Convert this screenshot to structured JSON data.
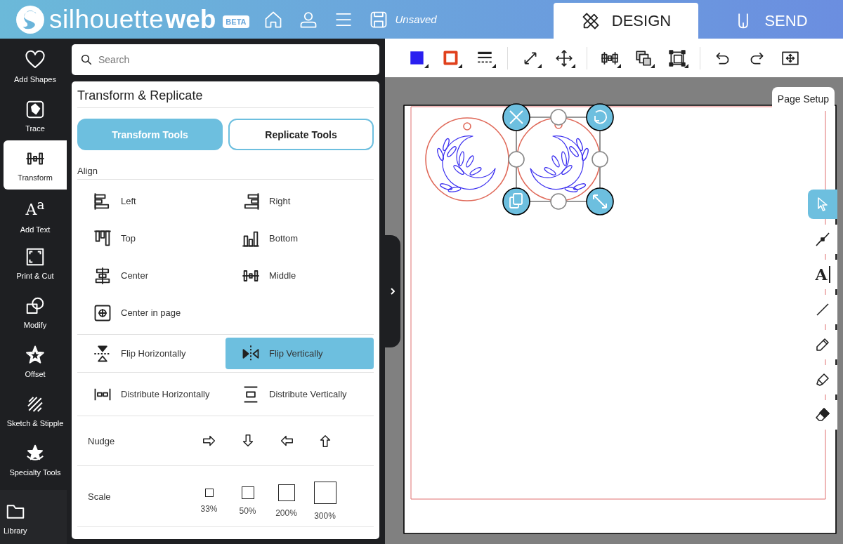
{
  "header": {
    "logo_light": "silhouette",
    "logo_bold": "web",
    "badge": "BETA",
    "doc_status": "Unsaved",
    "tabs": [
      {
        "label": "DESIGN",
        "kind": "design",
        "selected": true
      },
      {
        "label": "SEND",
        "kind": "send",
        "selected": false
      }
    ]
  },
  "sidebar": {
    "items": [
      {
        "label": "Add Shapes",
        "kind": "heart",
        "selected": false
      },
      {
        "label": "Trace",
        "kind": "trace",
        "selected": false
      },
      {
        "label": "Transform",
        "kind": "middle",
        "selected": true
      },
      {
        "label": "Add Text",
        "kind": "text",
        "glyph": "A$^{a}$",
        "selected": false
      },
      {
        "label": "Print & Cut",
        "kind": "printcut",
        "selected": false
      },
      {
        "label": "Modify",
        "kind": "modify",
        "selected": false
      },
      {
        "label": "Offset",
        "kind": "offset",
        "selected": false
      },
      {
        "label": "Sketch & Stipple",
        "kind": "sketch",
        "selected": false
      },
      {
        "label": "Specialty Tools",
        "kind": "specialty",
        "selected": false
      }
    ],
    "library": {
      "label": "Library",
      "kind": "folder",
      "selected": false
    }
  },
  "search": {
    "placeholder": "Search"
  },
  "panel": {
    "title": "Transform & Replicate",
    "tabs": [
      {
        "label": "Transform Tools",
        "selected": true
      },
      {
        "label": "Replicate Tools",
        "selected": false
      }
    ],
    "align_label": "Align",
    "align": [
      {
        "label": "Left",
        "kind": "left"
      },
      {
        "label": "Right",
        "kind": "right"
      },
      {
        "label": "Top",
        "kind": "top"
      },
      {
        "label": "Bottom",
        "kind": "bottom"
      },
      {
        "label": "Center",
        "kind": "center"
      },
      {
        "label": "Middle",
        "kind": "middle"
      },
      {
        "label": "Center in page",
        "kind": "centerpage"
      }
    ],
    "flip": [
      {
        "label": "Flip Horizontally",
        "kind": "fliph",
        "selected": false
      },
      {
        "label": "Flip Vertically",
        "kind": "flipv",
        "selected": true
      }
    ],
    "distribute": [
      {
        "label": "Distribute Horizontally",
        "kind": "disth"
      },
      {
        "label": "Distribute Vertically",
        "kind": "distv"
      }
    ],
    "nudge": {
      "label": "Nudge",
      "arrows": [
        {
          "kind": "right"
        },
        {
          "kind": "down"
        },
        {
          "kind": "left"
        },
        {
          "kind": "up"
        }
      ]
    },
    "scale": {
      "label": "Scale",
      "options": [
        "33%",
        "50%",
        "200%",
        "300%"
      ]
    }
  },
  "canvas": {
    "page_setup": "Page Setup",
    "tools": [
      {
        "kind": "pointer",
        "selected": true
      },
      {
        "kind": "node",
        "selected": false
      },
      {
        "kind": "text",
        "glyph": "A",
        "selected": false
      },
      {
        "kind": "line",
        "selected": false
      },
      {
        "kind": "pencil",
        "selected": false
      },
      {
        "kind": "marker",
        "selected": false
      },
      {
        "kind": "eraser",
        "selected": false
      }
    ]
  }
}
